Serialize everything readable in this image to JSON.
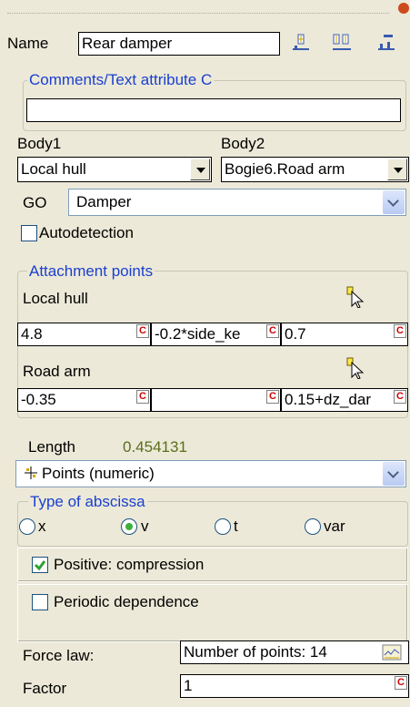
{
  "name_label": "Name",
  "name_value": "Rear damper",
  "comments": {
    "title": "Comments/Text attribute C",
    "value": ""
  },
  "body1": {
    "label": "Body1",
    "value": "Local hull"
  },
  "body2": {
    "label": "Body2",
    "value": "Bogie6.Road arm"
  },
  "go": {
    "label": "GO",
    "value": "Damper"
  },
  "autodetection_label": "Autodetection",
  "attachment": {
    "title": "Attachment points",
    "point1": {
      "label": "Local hull",
      "x": "4.8",
      "y": "-0.2*side_ke",
      "z": "0.7"
    },
    "point2": {
      "label": "Road arm",
      "x": "-0.35",
      "y": "",
      "z": "0.15+dz_dar"
    }
  },
  "length": {
    "label": "Length",
    "value": "0.454131"
  },
  "points_combo": "Points (numeric)",
  "abscissa": {
    "title": "Type of abscissa",
    "options": [
      "x",
      "v",
      "t",
      "var"
    ],
    "selected": "v"
  },
  "positive_label": "Positive: compression",
  "periodic_label": "Periodic dependence",
  "force_law": {
    "label": "Force law:",
    "value": "Number of points: 14"
  },
  "factor": {
    "label": "Factor",
    "value": "1"
  },
  "c_marker": "C",
  "colors": {
    "group_title": "#1a3fd0",
    "length_value": "#5a6e1a",
    "check": "#2ea02e"
  }
}
